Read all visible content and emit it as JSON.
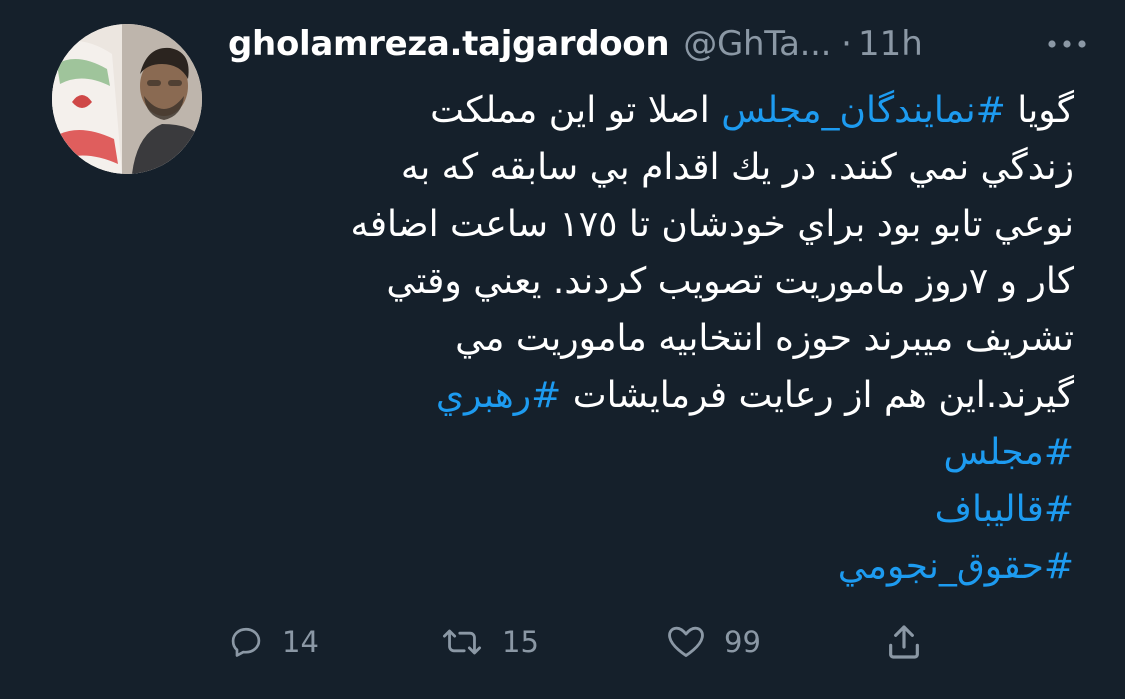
{
  "tweet": {
    "author": {
      "display_name": "gholamreza.tajgardoon",
      "handle": "@GhTa...",
      "avatar_icon": "profile-photo"
    },
    "separator": "·",
    "time": "11h",
    "more_icon": "more-horizontal-icon",
    "text_lines": [
      [
        {
          "t": "گویا ",
          "h": false
        },
        {
          "t": "#نمايندگان_مجلس",
          "h": true
        },
        {
          "t": " اصلا تو این مملکت",
          "h": false
        }
      ],
      [
        {
          "t": "زندگي نمي كنند. در يك اقدام بي سابقه كه به",
          "h": false
        }
      ],
      [
        {
          "t": "نوعي تابو بود براي خودشان تا ١٧٥ ساعت اضافه",
          "h": false
        }
      ],
      [
        {
          "t": "كار و ٧روز ماموريت تصويب كردند. يعني وقتي",
          "h": false
        }
      ],
      [
        {
          "t": "تشريف ميبرند حوزه انتخابيه ماموريت مي",
          "h": false
        }
      ],
      [
        {
          "t": "گيرند.اين هم از رعايت فرمايشات ",
          "h": false
        },
        {
          "t": "#رهبري",
          "h": true
        }
      ],
      [
        {
          "t": "#مجلس",
          "h": true
        }
      ],
      [
        {
          "t": "#قاليباف",
          "h": true
        }
      ],
      [
        {
          "t": "#حقوق_نجومي",
          "h": true
        }
      ]
    ],
    "actions": {
      "reply": {
        "icon": "reply-icon",
        "count": "14"
      },
      "retweet": {
        "icon": "retweet-icon",
        "count": "15"
      },
      "like": {
        "icon": "heart-icon",
        "count": "99"
      },
      "share": {
        "icon": "share-icon"
      }
    },
    "colors": {
      "background": "#15202b",
      "text": "#ffffff",
      "secondary": "#8b98a5",
      "link": "#1d9bf0"
    }
  }
}
